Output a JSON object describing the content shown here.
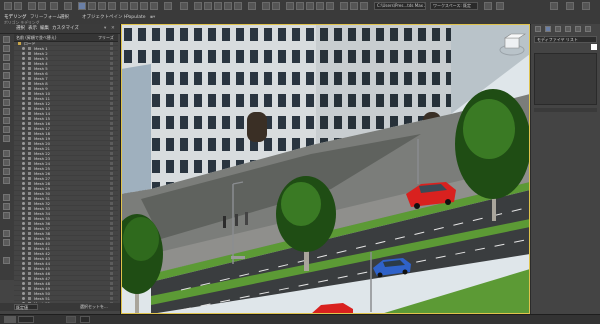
{
  "app": {
    "workspace": "ワークスペース: 既定",
    "project": "C:\\Users\\Pres...tds Max 2022"
  },
  "tabs": [
    "モデリング",
    "フリーフォーム",
    "選択",
    "オブジェクトペイント",
    "Populate"
  ],
  "subtitle": "ポリゴン モデリング",
  "explorer": {
    "menu": [
      "選択",
      "表示",
      "編集",
      "カスタマイズ"
    ],
    "col_name": "名前 (昇順で並べ替え)",
    "col_freeze": "フリーズ",
    "root": "ロード",
    "rows": [
      "Mesh 1",
      "Mesh 2",
      "Mesh 3",
      "Mesh 4",
      "Mesh 5",
      "Mesh 6",
      "Mesh 7",
      "Mesh 8",
      "Mesh 9",
      "Mesh 10",
      "Mesh 11",
      "Mesh 12",
      "Mesh 13",
      "Mesh 14",
      "Mesh 15",
      "Mesh 16",
      "Mesh 17",
      "Mesh 18",
      "Mesh 19",
      "Mesh 20",
      "Mesh 21",
      "Mesh 22",
      "Mesh 23",
      "Mesh 24",
      "Mesh 25",
      "Mesh 26",
      "Mesh 27",
      "Mesh 28",
      "Mesh 29",
      "Mesh 30",
      "Mesh 31",
      "Mesh 32",
      "Mesh 33",
      "Mesh 34",
      "Mesh 35",
      "Mesh 36",
      "Mesh 37",
      "Mesh 38",
      "Mesh 39",
      "Mesh 40",
      "Mesh 41",
      "Mesh 42",
      "Mesh 43",
      "Mesh 44",
      "Mesh 45",
      "Mesh 46",
      "Mesh 47",
      "Mesh 48",
      "Mesh 49",
      "Mesh 50",
      "Mesh 51",
      "Mesh 52"
    ],
    "layer_label": "既定値",
    "selection_label": "選択セットを..."
  },
  "right_panel": {
    "title": "モディファイヤ リスト"
  },
  "colors": {
    "accent": "#e0c34c",
    "panel": "#444444",
    "sky": "#dfe6ea",
    "grass": "#5c9a35",
    "road": "#3a3d3f",
    "car_red": "#d9211f",
    "car_blue": "#2f62c9"
  }
}
